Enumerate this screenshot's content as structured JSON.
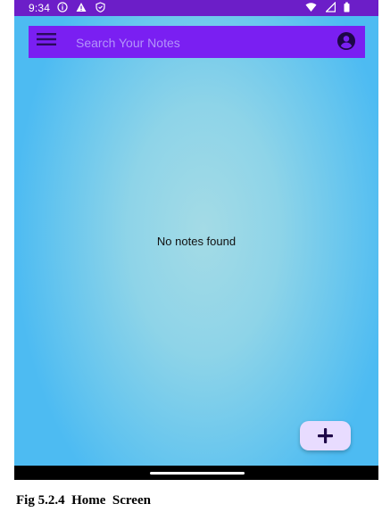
{
  "status_bar": {
    "time": "9:34",
    "left_icons": [
      "info-circle-icon",
      "warning-triangle-icon",
      "shield-icon"
    ],
    "right_icons": [
      "wifi-icon",
      "cellular-signal-icon",
      "battery-icon"
    ]
  },
  "search_bar": {
    "placeholder": "Search Your Notes",
    "value": "",
    "left_icon": "menu-icon",
    "right_icon": "account-icon"
  },
  "main": {
    "empty_message": "No notes found"
  },
  "fab": {
    "icon": "plus-icon"
  },
  "caption": "Fig 5.2.4  Home  Screen",
  "colors": {
    "status_bar": "#6c1ec8",
    "search_bar": "#7a1ff2",
    "placeholder": "#b394fa",
    "background_center": "#a4dbe6",
    "background_edge": "#4dbbf2",
    "fab": "#e8dcff",
    "nav_bar": "#000000"
  }
}
